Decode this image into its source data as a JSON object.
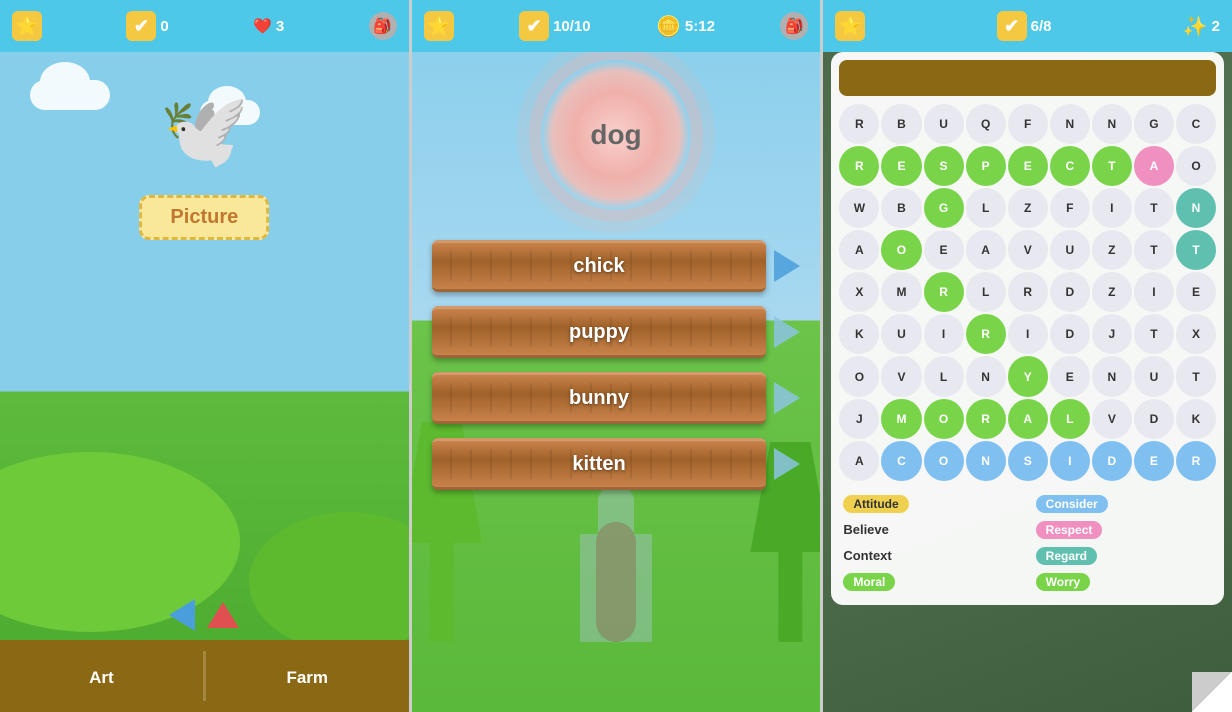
{
  "panel1": {
    "top_bar": {
      "star_label": "⭐",
      "check_count": "0",
      "heart_count": "3",
      "bag_label": "🎒"
    },
    "bird_emoji": "🕊️",
    "picture_label": "Picture",
    "nav_items": [
      {
        "label": "Art"
      },
      {
        "label": "Farm"
      }
    ]
  },
  "panel2": {
    "top_bar": {
      "check_count": "10/10",
      "timer": "5:12"
    },
    "target_word": "dog",
    "choices": [
      {
        "text": "chick"
      },
      {
        "text": "puppy"
      },
      {
        "text": "bunny"
      },
      {
        "text": "kitten"
      }
    ]
  },
  "panel3": {
    "top_bar": {
      "check_count": "6/8",
      "star_count": "2"
    },
    "grid": [
      [
        "R",
        "B",
        "U",
        "Q",
        "F",
        "N",
        "N",
        "G",
        "C",
        ""
      ],
      [
        "R",
        "E",
        "S",
        "P",
        "E",
        "C",
        "T",
        "A",
        "O",
        ""
      ],
      [
        "W",
        "B",
        "G",
        "L",
        "Z",
        "F",
        "I",
        "T",
        "N",
        ""
      ],
      [
        "A",
        "O",
        "E",
        "A",
        "V",
        "U",
        "Z",
        "T",
        "T",
        ""
      ],
      [
        "X",
        "M",
        "R",
        "L",
        "R",
        "D",
        "Z",
        "I",
        "E",
        ""
      ],
      [
        "K",
        "U",
        "I",
        "R",
        "I",
        "D",
        "J",
        "T",
        "X",
        ""
      ],
      [
        "O",
        "V",
        "L",
        "N",
        "Y",
        "E",
        "N",
        "U",
        "T",
        ""
      ],
      [
        "J",
        "M",
        "O",
        "R",
        "A",
        "L",
        "V",
        "D",
        "K",
        ""
      ],
      [
        "A",
        "C",
        "O",
        "N",
        "S",
        "I",
        "D",
        "E",
        "R",
        ""
      ]
    ],
    "grid_colors": [
      [
        "",
        "",
        "",
        "",
        "",
        "",
        "",
        "",
        "",
        ""
      ],
      [
        "green",
        "green",
        "green",
        "green",
        "green",
        "green",
        "green",
        "pink",
        "",
        ""
      ],
      [
        "",
        "",
        "green",
        "",
        "",
        "",
        "",
        "",
        "teal",
        ""
      ],
      [
        "",
        "green",
        "",
        "",
        "",
        "",
        "",
        "",
        "teal",
        ""
      ],
      [
        "",
        "",
        "green",
        "",
        "",
        "",
        "",
        "",
        "",
        ""
      ],
      [
        "",
        "",
        "",
        "green",
        "",
        "",
        "",
        "",
        "",
        ""
      ],
      [
        "",
        "",
        "",
        "",
        "green",
        "",
        "",
        "",
        "",
        ""
      ],
      [
        "",
        "green",
        "green",
        "green",
        "green",
        "green",
        "",
        "",
        "",
        ""
      ],
      [
        "",
        "blue",
        "blue",
        "blue",
        "blue",
        "blue",
        "blue",
        "blue",
        "blue",
        ""
      ]
    ],
    "word_list": [
      {
        "text": "Attitude",
        "badge": "yellow",
        "found": true
      },
      {
        "text": "Consider",
        "badge": "blue",
        "found": true
      },
      {
        "text": "Believe",
        "badge": "",
        "found": false
      },
      {
        "text": "Respect",
        "badge": "pink",
        "found": true
      },
      {
        "text": "Context",
        "badge": "",
        "found": false
      },
      {
        "text": "Regard",
        "badge": "teal",
        "found": true
      },
      {
        "text": "Moral",
        "badge": "green",
        "found": true
      },
      {
        "text": "Worry",
        "badge": "green",
        "found": true
      }
    ]
  }
}
